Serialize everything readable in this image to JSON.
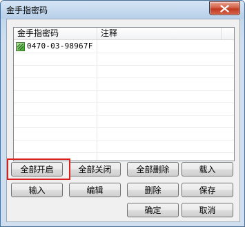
{
  "window": {
    "title": "金手指密码"
  },
  "listview": {
    "columns": [
      "金手指密码",
      "注释"
    ],
    "rows": [
      {
        "code": "0470-03-98967F",
        "note": "",
        "checked": true
      }
    ]
  },
  "buttons": {
    "enable_all": "全部开启",
    "disable_all": "全部关闭",
    "delete_all": "全部删除",
    "load": "载入",
    "input": "输入",
    "edit": "编辑",
    "delete": "删除",
    "save": "保存",
    "ok": "确定",
    "cancel": "取消"
  },
  "colors": {
    "highlight": "#d9201b",
    "close_button": "#c1391f"
  }
}
